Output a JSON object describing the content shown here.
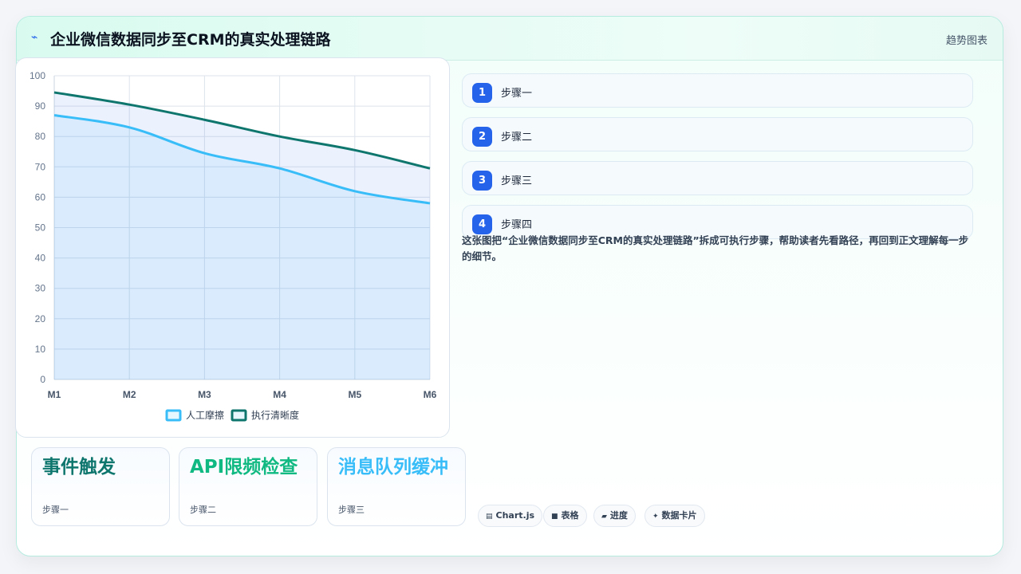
{
  "header": {
    "title": "企业微信数据同步至CRM的真实处理链路",
    "right_label": "趋势图表"
  },
  "chart_data": {
    "type": "area",
    "x": [
      "M1",
      "M2",
      "M3",
      "M4",
      "M5",
      "M6"
    ],
    "series": [
      {
        "name": "人工摩擦",
        "values": [
          87,
          83,
          74.5,
          69.5,
          62,
          58
        ],
        "color": "#38bdf8"
      },
      {
        "name": "执行清晰度",
        "values": [
          94.5,
          90.5,
          85.5,
          80,
          75.5,
          69.5
        ],
        "color": "#0f766e"
      }
    ],
    "ylim": [
      0,
      100
    ],
    "yticks": [
      0,
      10,
      20,
      30,
      40,
      50,
      60,
      70,
      80,
      90,
      100
    ],
    "grid": true,
    "legend": "bottom"
  },
  "kpis": [
    {
      "title": "事件触发",
      "sub": "步骤一",
      "color": "#0f766e"
    },
    {
      "title": "API限频检查",
      "sub": "步骤二",
      "color": "#10b981"
    },
    {
      "title": "消息队列缓冲",
      "sub": "步骤三",
      "color": "#38bdf8"
    }
  ],
  "steps": [
    {
      "num": "1",
      "label": "步骤一"
    },
    {
      "num": "2",
      "label": "步骤二"
    },
    {
      "num": "3",
      "label": "步骤三"
    },
    {
      "num": "4",
      "label": "步骤四"
    }
  ],
  "description": "这张图把“企业微信数据同步至CRM的真实处理链路”拆成可执行步骤，帮助读者先看路径，再回到正文理解每一步的细节。",
  "chips": [
    {
      "icon": "chart-icon",
      "label": "Chart.js"
    },
    {
      "icon": "table-icon",
      "label": "表格"
    },
    {
      "icon": "progress-icon",
      "label": "进度"
    },
    {
      "icon": "sparkle-icon",
      "label": "数据卡片"
    }
  ],
  "colors": {
    "accent": "#2563eb",
    "teal": "#0f766e",
    "sky": "#38bdf8",
    "green": "#10b981"
  }
}
